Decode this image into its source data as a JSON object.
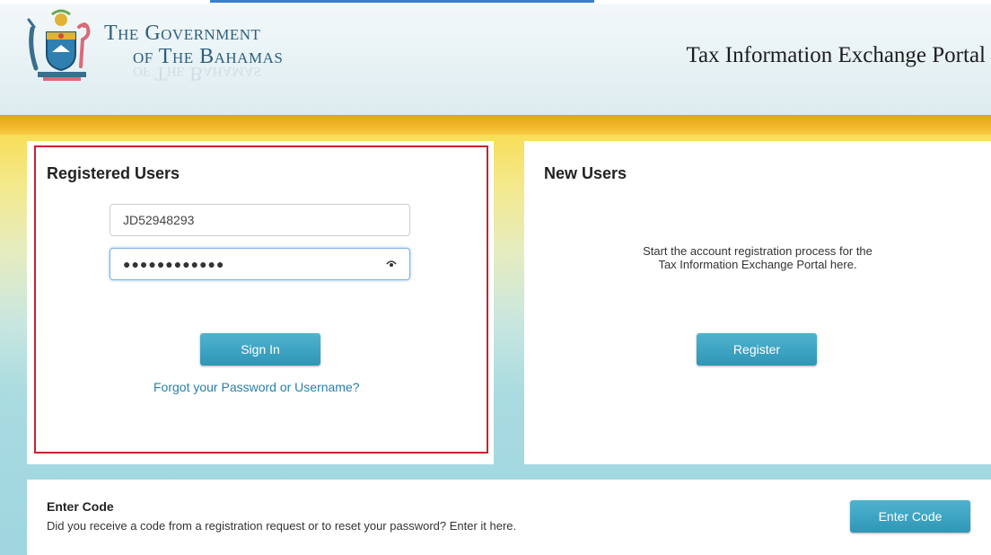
{
  "header": {
    "gov_line1": "The Government",
    "gov_line2": "of The Bahamas",
    "portal_title": "Tax Information Exchange Portal"
  },
  "registered": {
    "heading": "Registered Users",
    "username_value": "JD52948293",
    "password_mask": "●●●●●●●●●●●●",
    "sign_in_label": "Sign In",
    "forgot_link": "Forgot your Password or Username?"
  },
  "new_users": {
    "heading": "New Users",
    "description_line1": "Start the account registration process for the",
    "description_line2": "Tax Information Exchange Portal here.",
    "register_label": "Register"
  },
  "enter_code": {
    "title": "Enter Code",
    "description": "Did you receive a code from a registration request or to reset your password? Enter it here.",
    "button_label": "Enter Code"
  },
  "icons": {
    "crest": "bahamas-coat-of-arms-icon",
    "password_toggle": "eye-icon"
  },
  "colors": {
    "accent_button": "#2f96b7",
    "link": "#2a7fa6",
    "focus_frame": "#c8232c",
    "brand_text": "#2c5f7c",
    "gold_band": "#f0b426"
  }
}
